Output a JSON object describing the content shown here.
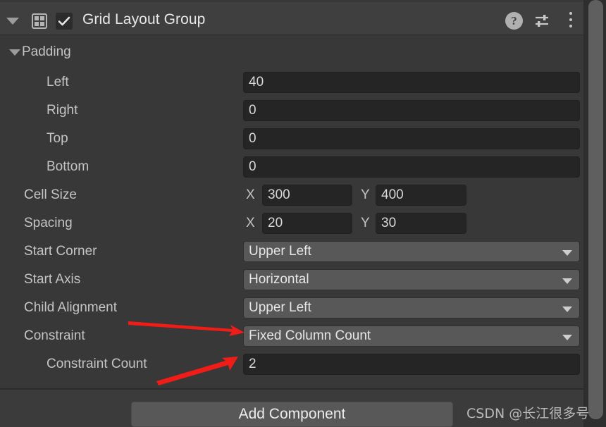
{
  "header": {
    "title": "Grid Layout Group",
    "enabled_checkbox": true,
    "icons": {
      "foldout": "triangle-down-icon",
      "component": "grid-icon",
      "help": "?",
      "preset": "preset-sliders-icon",
      "menu": "kebab-menu-icon"
    }
  },
  "padding": {
    "group_label": "Padding",
    "expanded": true,
    "rows": [
      {
        "label": "Left",
        "value": "40"
      },
      {
        "label": "Right",
        "value": "0"
      },
      {
        "label": "Top",
        "value": "0"
      },
      {
        "label": "Bottom",
        "value": "0"
      }
    ]
  },
  "vector_rows": [
    {
      "label": "Cell Size",
      "x_axis": "X",
      "x_value": "300",
      "y_axis": "Y",
      "y_value": "400"
    },
    {
      "label": "Spacing",
      "x_axis": "X",
      "x_value": "20",
      "y_axis": "Y",
      "y_value": "30"
    }
  ],
  "dropdown_rows": [
    {
      "label": "Start Corner",
      "value": "Upper Left"
    },
    {
      "label": "Start Axis",
      "value": "Horizontal"
    },
    {
      "label": "Child Alignment",
      "value": "Upper Left"
    },
    {
      "label": "Constraint",
      "value": "Fixed Column Count"
    }
  ],
  "constraint_count": {
    "label": "Constraint Count",
    "value": "2"
  },
  "footer": {
    "add_component_label": "Add Component"
  },
  "watermark": {
    "text": "CSDN @长江很多号"
  },
  "annotations": {
    "accent_color": "#f01c18",
    "arrow_1_target": "Constraint",
    "arrow_2_target": "Constraint Count"
  },
  "colors": {
    "background": "#383838",
    "header_bar": "#3f3f3f",
    "field_bg": "#252525",
    "dropdown_bg": "#585858",
    "text": "#c4c4c4",
    "scrollbar": "#5f5f5f"
  }
}
